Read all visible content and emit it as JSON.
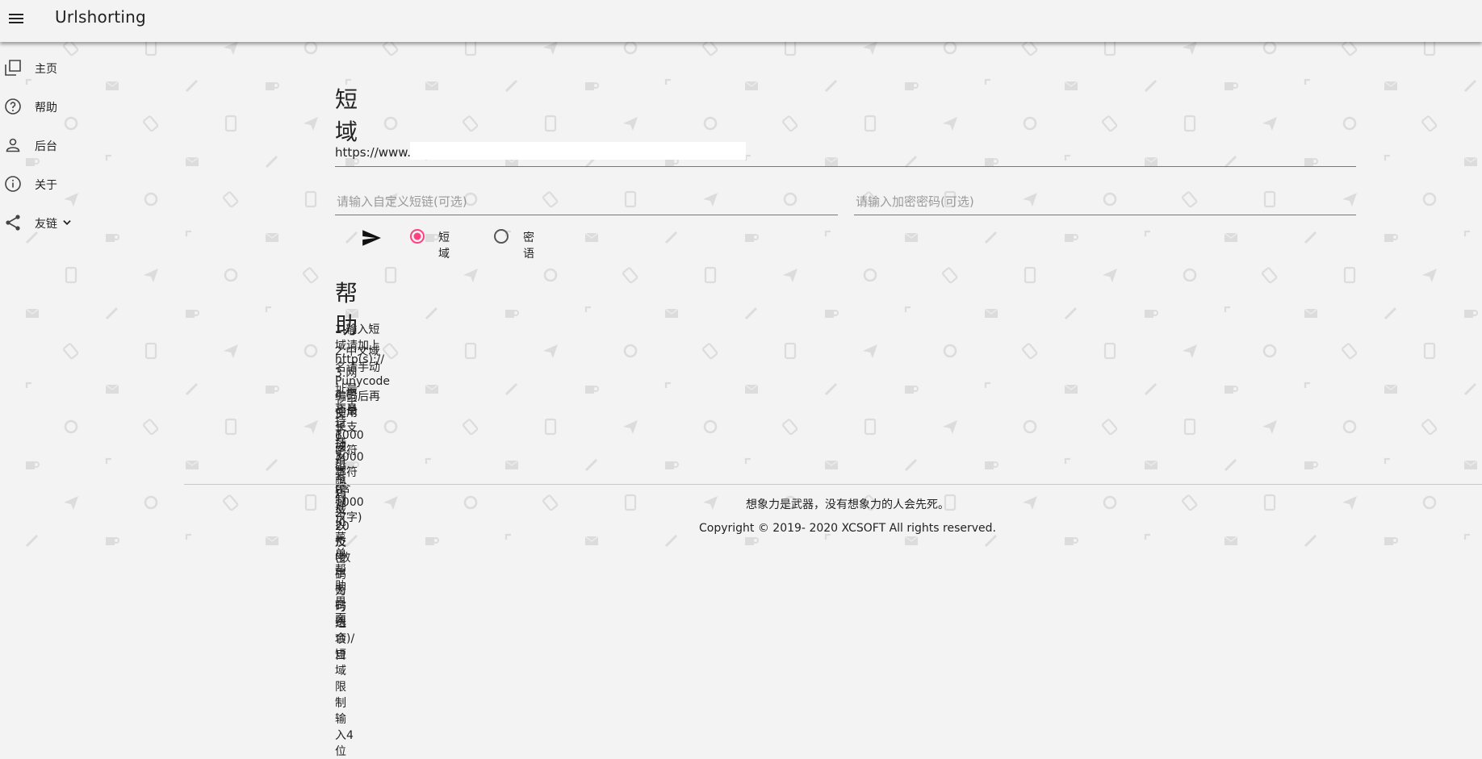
{
  "app": {
    "title": "Urlshorting"
  },
  "colors": {
    "accent": "#ff4081",
    "background": "#f3f3f3"
  },
  "sidebar": {
    "items": [
      {
        "label": "主页",
        "icon": "pages-icon"
      },
      {
        "label": "帮助",
        "icon": "help-circle-icon"
      },
      {
        "label": "后台",
        "icon": "person-icon"
      },
      {
        "label": "关于",
        "icon": "info-icon"
      },
      {
        "label": "友链",
        "icon": "share-icon"
      }
    ]
  },
  "shorten": {
    "heading": "短域",
    "url_prefix": "https://www.",
    "url_value": "",
    "custom_placeholder": "请输入自定义短链(可选)",
    "password_placeholder": "请输入加密密码(可选)",
    "mode_options": [
      "短域",
      "密语"
    ],
    "selected_mode": "短域"
  },
  "help": {
    "heading": "帮助",
    "lines": [
      "1.输入短域请加上http(s)://",
      "2.中文域名请手动Punycode编码后再使用",
      "3.网址最长支持1000字符",
      "4.密语最长支持3000字符(含1000汉字)",
      "5.手动填写短域以及密码为可选项目",
      "6.密码限制2-20位(数字密码组合)/短域限制输入4位",
      "7.其余详见菜单-帮助界面"
    ]
  },
  "footer": {
    "quote": "想象力是武器，没有想象力的人会先死。",
    "copyright": "Copyright © 2019- 2020 XCSOFT All rights reserved."
  }
}
